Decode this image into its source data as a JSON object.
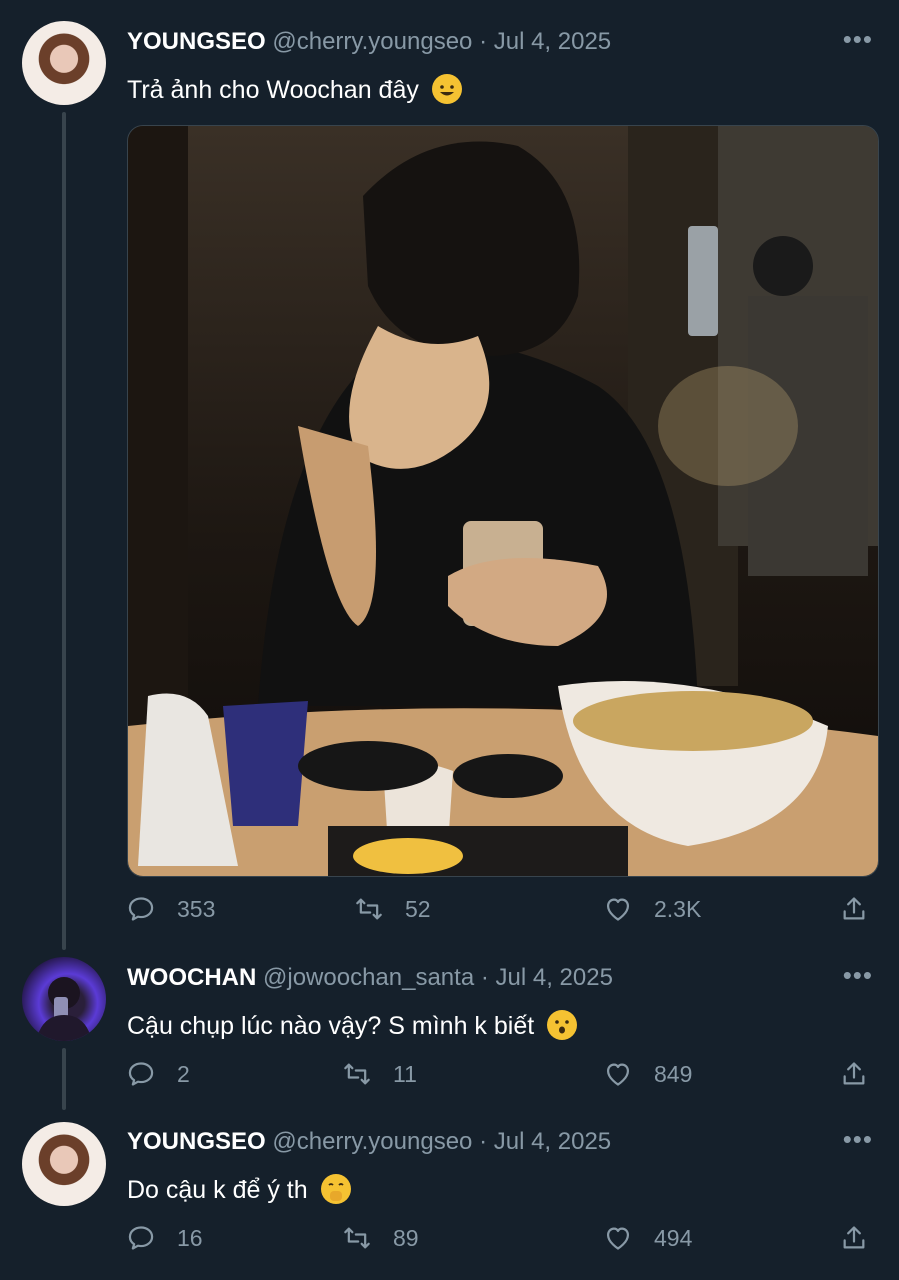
{
  "tweets": [
    {
      "name": "YOUNGSEO",
      "handle": "@cherry.youngseo",
      "dot": "·",
      "date": "Jul 4, 2025",
      "more": "•••",
      "text": "Trả ảnh cho Woochan đây",
      "emoji_icon": "grinning-cat-icon",
      "media_alt": "photo",
      "replies": "353",
      "retweets": "52",
      "likes": "2.3K"
    },
    {
      "name": "WOOCHAN",
      "handle": "@jowoochan_santa",
      "dot": "·",
      "date": "Jul 4, 2025",
      "more": "•••",
      "text": "Cậu chụp lúc nào vậy? S mình k biết",
      "emoji_icon": "hushed-face-icon",
      "replies": "2",
      "retweets": "11",
      "likes": "849"
    },
    {
      "name": "YOUNGSEO",
      "handle": "@cherry.youngseo",
      "dot": "·",
      "date": "Jul 4, 2025",
      "more": "•••",
      "text": "Do cậu k để ý th",
      "emoji_icon": "face-with-hand-over-mouth-icon",
      "replies": "16",
      "retweets": "89",
      "likes": "494"
    }
  ],
  "colors": {
    "background": "#15202b",
    "muted": "#8899a6",
    "thread_line": "#38444d"
  }
}
